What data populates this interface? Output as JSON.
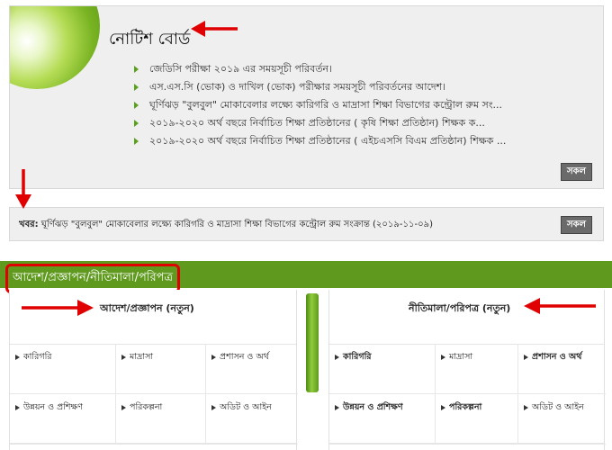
{
  "notice_board": {
    "title": "নোটিশ বোর্ড",
    "items": [
      "জেডিসি পরীক্ষা ২০১৯ এর সময়সূচী পরিবর্তন।",
      "এস.এস.সি (ভোক) ও দাখিল (ভোক) পরীক্ষার সময়সূচী পরিবর্তনের আদেশ।",
      "ঘূর্ণিঝড় \"বুলবুল\" মোকাবেলার লক্ষ্যে কারিগরি ও মাদ্রাসা শিক্ষা বিভাগের কন্ট্রোল রুম সং...",
      "২০১৯-২০২০ অর্থ বছরে নির্বাচিত শিক্ষা প্রতিষ্ঠানের ( কৃষি শিক্ষা প্রতিষ্ঠান) শিক্ষক ক...",
      "২০১৯-২০২০ অর্থ বছরে নির্বাচিত শিক্ষা প্রতিষ্ঠানের ( এইচএসসি বিএম প্রতিষ্ঠান) শিক্ষক ..."
    ],
    "all_label": "সকল"
  },
  "news": {
    "label": "খবর:",
    "text": "ঘূর্ণিঝড় \"বুলবুল\" মোকাবেলার লক্ষ্যে কারিগরি ও মাদ্রাসা শিক্ষা বিভাগের কন্ট্রোল রুম সংক্রান্ত (২০১৯-১১-০৯)",
    "all_label": "সকল"
  },
  "orders": {
    "title": "আদেশ/প্রজ্ঞাপন/নীতিমালা/পরিপত্র",
    "left_panel": {
      "title": "আদেশ/প্রজ্ঞাপন (নতুন)",
      "cells": [
        "কারিগরি",
        "মাদ্রাসা",
        "প্রশাসন ও অর্থ",
        "উন্নয়ন ও প্রশিক্ষণ",
        "পরিকল্পনা",
        "অডিট ও আইন"
      ]
    },
    "right_panel": {
      "title": "নীতিমালা/পরিপত্র (নতুন)",
      "cells": [
        "কারিগরি",
        "মাদ্রাসা",
        "প্রশাসন ও অর্থ",
        "উন্নয়ন ও প্রশিক্ষণ",
        "পরিকল্পনা",
        "অডিট ও আইন"
      ]
    }
  },
  "colors": {
    "section_green": "#5f9a1e",
    "annotation_red": "#e00000",
    "bullet_green": "#5aa11b"
  }
}
